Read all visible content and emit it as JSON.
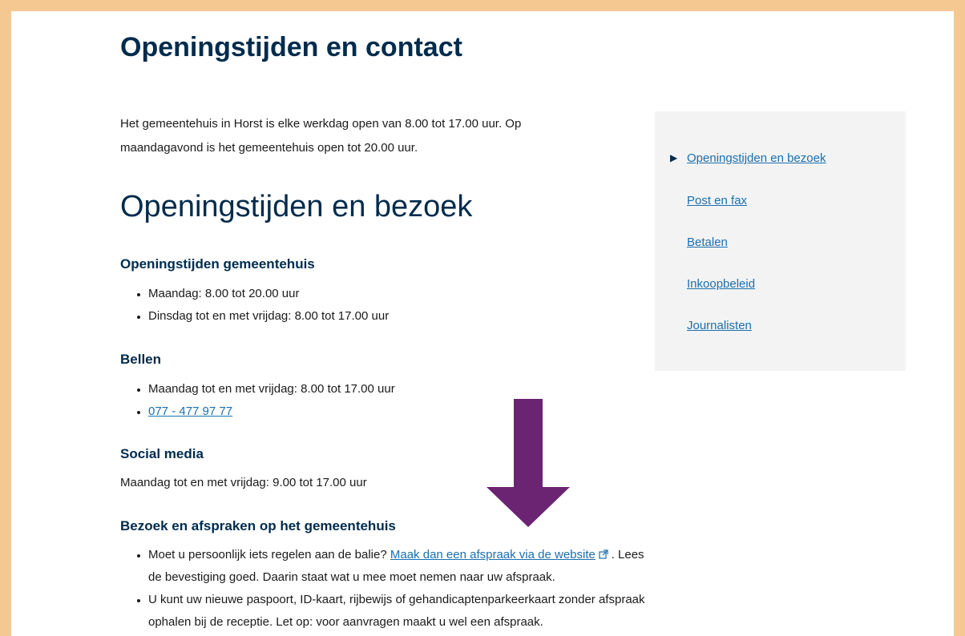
{
  "page": {
    "title": "Openingstijden en contact",
    "intro": "Het gemeentehuis in Horst is elke werkdag open van 8.00 tot 17.00 uur. Op maandagavond is het gemeentehuis open tot 20.00 uur.",
    "section_title": "Openingstijden en bezoek"
  },
  "opening": {
    "heading": "Openingstijden gemeentehuis",
    "items": [
      "Maandag: 8.00 tot 20.00 uur",
      "Dinsdag tot en met vrijdag: 8.00 tot 17.00 uur"
    ]
  },
  "calling": {
    "heading": "Bellen",
    "hours": "Maandag tot en met vrijdag: 8.00 tot 17.00 uur",
    "phone": "077 - 477 97 77"
  },
  "social": {
    "heading": "Social media",
    "hours": "Maandag tot en met vrijdag: 9.00 tot 17.00 uur"
  },
  "visit": {
    "heading": "Bezoek en afspraken op het gemeentehuis",
    "item1_text": "Moet u persoonlijk iets regelen aan de balie? ",
    "item1_link": "Maak dan een afspraak via de website",
    "item1_after": ". Lees de bevestiging goed. Daarin staat wat u mee moet nemen naar uw afspraak.",
    "item2": "U kunt uw nieuwe paspoort, ID-kaart, rijbewijs of gehandicaptenparkeerkaart zonder afspraak ophalen bij de receptie. Let op: voor aanvragen maakt u wel een afspraak."
  },
  "sidebar": {
    "items": [
      {
        "label": "Openingstijden en bezoek"
      },
      {
        "label": "Post en fax"
      },
      {
        "label": "Betalen"
      },
      {
        "label": "Inkoopbeleid"
      },
      {
        "label": "Journalisten"
      }
    ]
  },
  "colors": {
    "frame": "#f5c891",
    "heading": "#002b4c",
    "link": "#1b6fae",
    "arrow": "#6a2472",
    "sidebar_bg": "#f3f3f3"
  },
  "icons": {
    "external_link": "external-link-icon",
    "arrow": "arrow-down-icon",
    "current_marker": "triangle-right-icon"
  }
}
